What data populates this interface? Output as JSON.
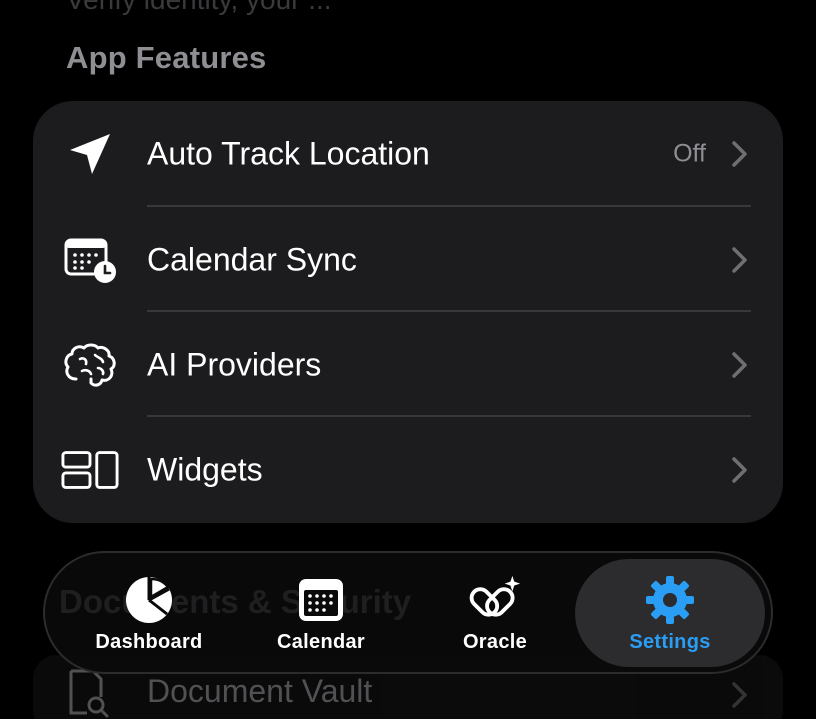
{
  "top_faded_text": "Verify identity, your ...",
  "section": {
    "title": "App Features"
  },
  "rows": [
    {
      "label": "Auto Track Location",
      "value": "Off",
      "icon": "location-arrow-icon"
    },
    {
      "label": "Calendar Sync",
      "value": "",
      "icon": "calendar-clock-icon"
    },
    {
      "label": "AI Providers",
      "value": "",
      "icon": "brain-icon"
    },
    {
      "label": "Widgets",
      "value": "",
      "icon": "widgets-icon"
    }
  ],
  "behind_tabbar": {
    "section_title": "Documents & Security",
    "row_label": "Document Vault",
    "row_icon": "document-search-icon"
  },
  "tabbar": {
    "tabs": [
      {
        "label": "Dashboard",
        "icon": "pie-chart-icon",
        "active": false
      },
      {
        "label": "Calendar",
        "icon": "calendar-icon",
        "active": false
      },
      {
        "label": "Oracle",
        "icon": "oracle-sparkle-icon",
        "active": false
      },
      {
        "label": "Settings",
        "icon": "gear-icon",
        "active": true
      }
    ]
  },
  "colors": {
    "accent": "#2a9df4",
    "card": "#1c1c1e",
    "secondary_text": "#8e8e93"
  }
}
